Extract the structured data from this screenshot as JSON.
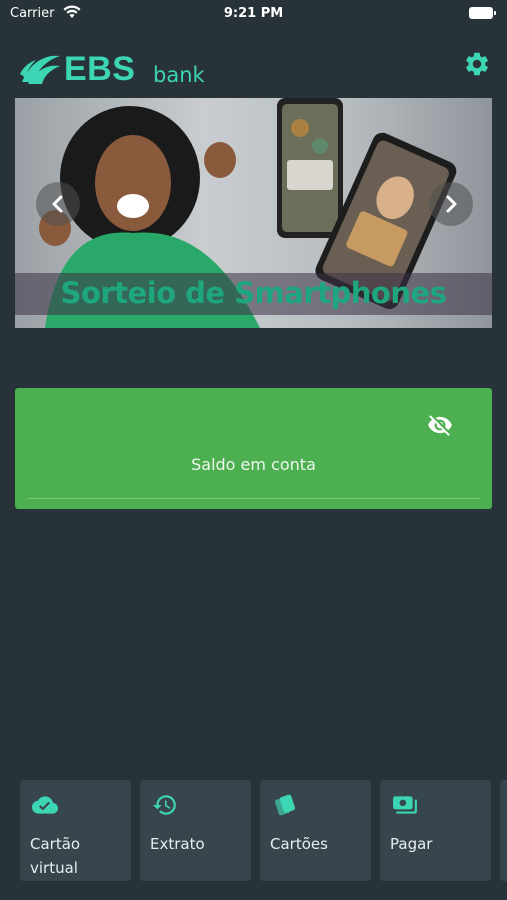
{
  "status_bar": {
    "carrier": "Carrier",
    "time": "9:21 PM"
  },
  "brand": {
    "name": "EBS",
    "suffix": "bank",
    "accent_color": "#3dd6b4"
  },
  "header": {
    "settings_icon": "gear-icon"
  },
  "banner": {
    "caption": "Sorteio de Smartphones",
    "prev_icon": "chevron-left-icon",
    "next_icon": "chevron-right-icon"
  },
  "balance": {
    "label": "Saldo em conta",
    "visibility_icon": "eye-off-icon",
    "card_color": "#4caf50"
  },
  "actions": [
    {
      "label": "Cartão virtual",
      "icon": "cloud-check-icon"
    },
    {
      "label": "Extrato",
      "icon": "history-icon"
    },
    {
      "label": "Cartões",
      "icon": "cards-icon"
    },
    {
      "label": "Pagar",
      "icon": "payment-icon"
    }
  ],
  "colors": {
    "background": "#283339",
    "tile": "#37464d"
  }
}
